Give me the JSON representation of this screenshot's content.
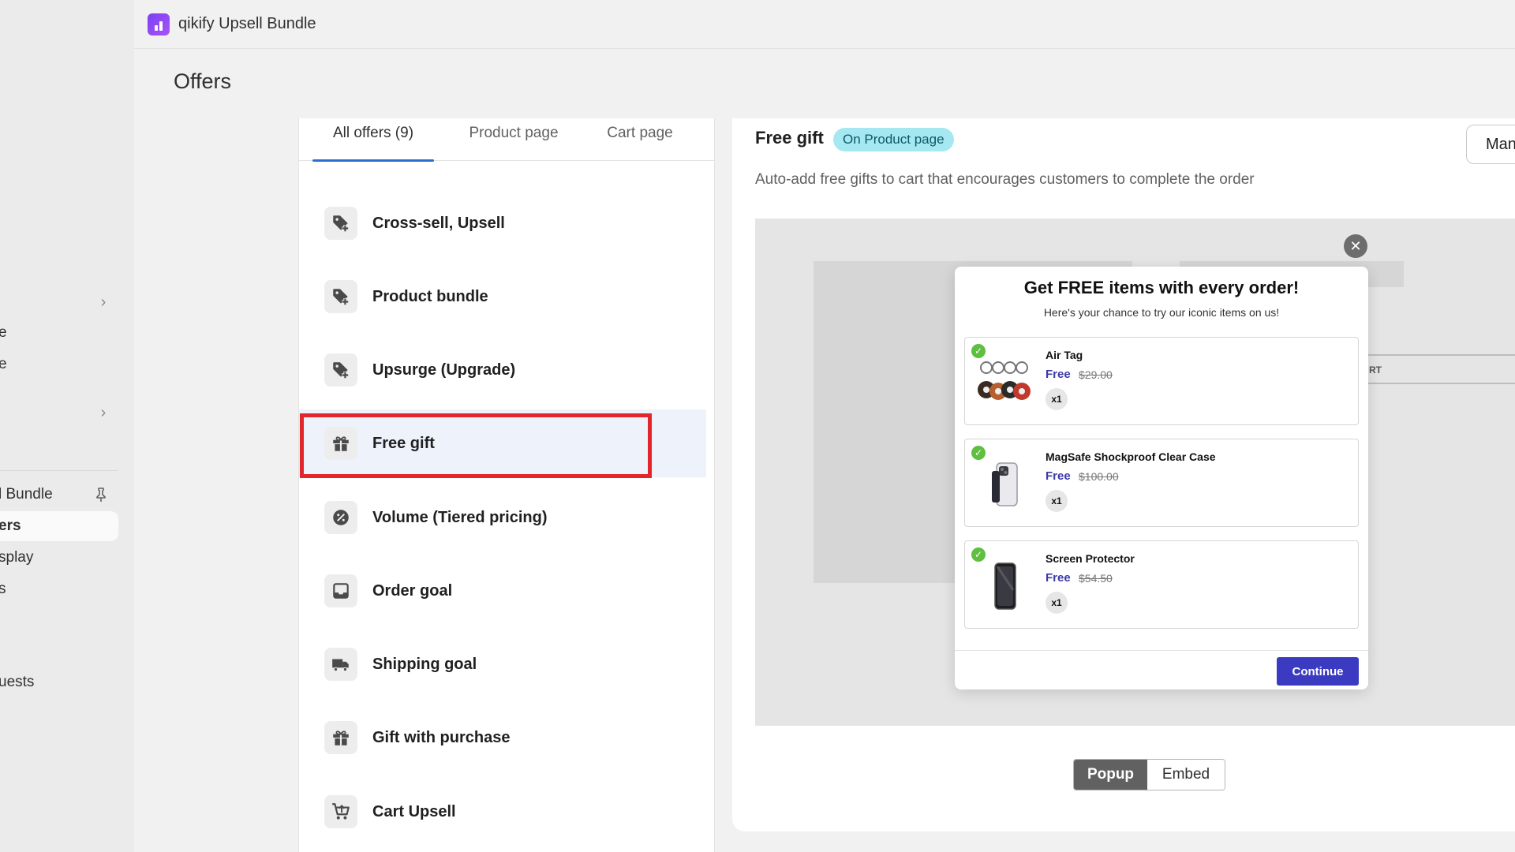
{
  "nav": {
    "items": [
      {
        "label": "e",
        "chevron": false
      },
      {
        "label": "e",
        "chevron": false
      },
      {
        "label": "l Bundle"
      },
      {
        "label": "ers"
      },
      {
        "label": "splay"
      },
      {
        "label": "s"
      },
      {
        "label": "uests"
      }
    ],
    "chevron_symbol": "›"
  },
  "app": {
    "name": "qikify Upsell Bundle"
  },
  "page": {
    "title": "Offers"
  },
  "tabs": [
    {
      "label": "All offers (9)"
    },
    {
      "label": "Product page"
    },
    {
      "label": "Cart page"
    }
  ],
  "offers": [
    {
      "label": "Cross-sell, Upsell",
      "icon": "tag-plus-icon"
    },
    {
      "label": "Product bundle",
      "icon": "tag-plus-icon"
    },
    {
      "label": "Upsurge (Upgrade)",
      "icon": "tag-plus-icon"
    },
    {
      "label": "Free gift",
      "icon": "gift-icon"
    },
    {
      "label": "Volume (Tiered pricing)",
      "icon": "discount-icon"
    },
    {
      "label": "Order goal",
      "icon": "inbox-icon"
    },
    {
      "label": "Shipping goal",
      "icon": "truck-icon"
    },
    {
      "label": "Gift with purchase",
      "icon": "gift-icon"
    },
    {
      "label": "Cart Upsell",
      "icon": "cart-up-icon"
    }
  ],
  "details": {
    "title": "Free gift",
    "badge": "On Product page",
    "manage_label": "Man",
    "description": "Auto-add free gifts to cart that encourages customers to complete the order",
    "bg_text": "RT",
    "close_symbol": "✕"
  },
  "modal": {
    "title": "Get FREE items with every order!",
    "subtitle": "Here's your chance to try our iconic items on us!",
    "items": [
      {
        "name": "Air Tag",
        "free": "Free",
        "old_price": "$29.00",
        "qty": "x1"
      },
      {
        "name": "MagSafe Shockproof Clear Case",
        "free": "Free",
        "old_price": "$100.00",
        "qty": "x1"
      },
      {
        "name": "Screen Protector",
        "free": "Free",
        "old_price": "$54.50",
        "qty": "x1"
      }
    ],
    "check_symbol": "✓",
    "continue_label": "Continue"
  },
  "view_toggle": {
    "popup": "Popup",
    "embed": "Embed"
  },
  "colors": {
    "accent": "#2c6ecb",
    "highlight": "#e3262b",
    "continue": "#3b3bc2",
    "badge": "#a5e8f2"
  }
}
